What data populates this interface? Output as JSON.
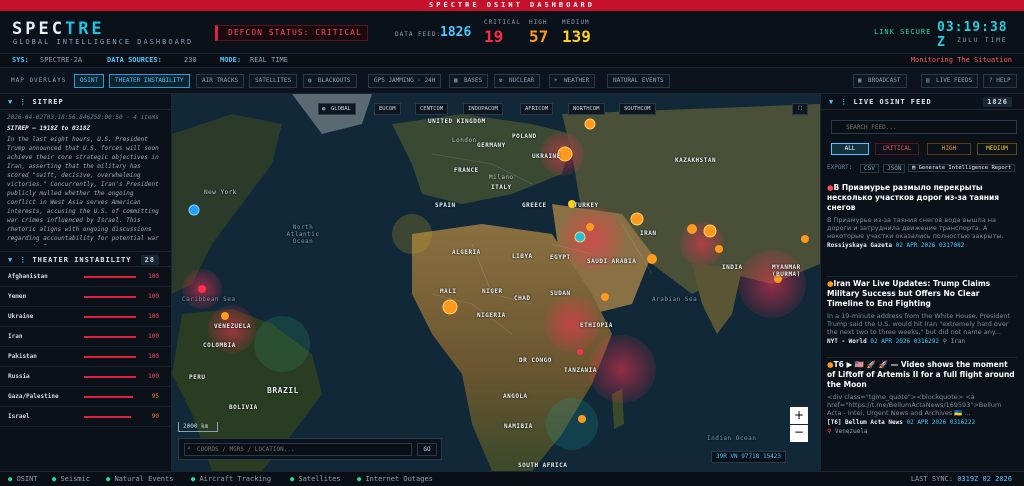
{
  "banner": "SPECTRE OSINT DASHBOARD",
  "header": {
    "logo_a": "SPEC",
    "logo_b": "TRE",
    "subtitle": "GLOBAL INTELLIGENCE DASHBOARD",
    "defcon": "DEFCON STATUS: CRITICAL",
    "data_feed_label": "DATA FEED:",
    "data_feed_value": "1826",
    "critical_label": "CRITICAL",
    "critical_value": "19",
    "high_label": "HIGH",
    "high_value": "57",
    "medium_label": "MEDIUM",
    "medium_value": "139",
    "link_secure": "LINK SECURE",
    "clock": "03:19:38 Z",
    "clock_sub": "ZULU TIME"
  },
  "sysbar": {
    "sys_k": "SYS:",
    "sys_v": "SPECTRE-2A",
    "sources_k": "DATA SOURCES:",
    "sources_v": "230",
    "mode_k": "MODE:",
    "mode_v": "REAL TIME",
    "monitor": "Monitoring The Situation"
  },
  "overlays": {
    "label": "MAP OVERLAYS",
    "items": [
      "OSINT",
      "THEATER INSTABILITY",
      "AIR TRACKS",
      "SATELLITES",
      "BLACKOUTS",
      "GPS JAMMING · 24H",
      "BASES",
      "NUCLEAR",
      "WEATHER",
      "NATURAL EVENTS"
    ],
    "broadcast": "BROADCAST",
    "live_feeds": "LIVE FEEDS",
    "help": "? HELP"
  },
  "sitrep": {
    "title": "SITREP",
    "meta": "2026-04-02T03:18:56.846Z58:00:50 · 4 items",
    "heading": "SITREP — 1918Z to 0318Z",
    "body": "In the last eight hours, U.S. President Trump announced that U.S. forces will soon achieve their core strategic objectives in Iran, asserting that the military has scored \"swift, decisive, overwhelming victories.\" Concurrently, Iran's President publicly mulled whether the ongoing conflict in West Asia serves American interests, accusing the U.S. of committing war crimes influenced by Israel. This rhetoric aligns with ongoing discussions regarding accountability for potential war crimes in Iran"
  },
  "theater": {
    "title": "THEATER INSTABILITY",
    "count": "28",
    "rows": [
      {
        "name": "Afghanistan",
        "value": "100",
        "pct": 100
      },
      {
        "name": "Yemen",
        "value": "100",
        "pct": 100
      },
      {
        "name": "Ukraine",
        "value": "100",
        "pct": 100
      },
      {
        "name": "Iran",
        "value": "100",
        "pct": 100
      },
      {
        "name": "Pakistan",
        "value": "100",
        "pct": 100
      },
      {
        "name": "Russia",
        "value": "100",
        "pct": 100
      },
      {
        "name": "Gaza/Palestine",
        "value": "95",
        "pct": 95
      },
      {
        "name": "Israel",
        "value": "90",
        "pct": 90
      }
    ]
  },
  "map": {
    "regions": [
      "GLOBAL",
      "EUCOM",
      "CENTCOM",
      "INDOPACOM",
      "AFRICOM",
      "NORTHCOM",
      "SOUTHCOM"
    ],
    "scale": "2000 km",
    "coord_placeholder": "COORDS / MGRS / LOCATION...",
    "go": "GO",
    "mgrs": "39R VN 97718 15423",
    "zoom_in": "+",
    "zoom_out": "−",
    "labels": [
      "UNITED KINGDOM",
      "London",
      "POLAND",
      "GERMANY",
      "UKRAINE",
      "KAZAKHSTAN",
      "FRANCE",
      "Milano",
      "ITALY",
      "New York",
      "SPAIN",
      "GREECE",
      "TURKEY",
      "North Atlantic Ocean",
      "IRAN",
      "ALGERIA",
      "LIBYA",
      "EGYPT",
      "SAUDI ARABIA",
      "INDIA",
      "MYANMAR (BURMA)",
      "Caribbean Sea",
      "MALI",
      "NIGER",
      "CHAD",
      "SUDAN",
      "Arabian Sea",
      "VENEZUELA",
      "NIGERIA",
      "ETHIOPIA",
      "COLOMBIA",
      "DR CONGO",
      "PERU",
      "TANZANIA",
      "BRAZIL",
      "BOLIVIA",
      "ANGOLA",
      "NAMIBIA",
      "Indian Ocean",
      "SOUTH AFRICA"
    ]
  },
  "feed": {
    "title": "LIVE OSINT FEED",
    "count": "1826",
    "search_placeholder": "SEARCH FEED...",
    "filters": [
      "ALL",
      "CRITICAL",
      "HIGH",
      "MEDIUM"
    ],
    "export_label": "EXPORT:",
    "csv": "CSV",
    "json": "JSON",
    "report": "Generate Intelligence Report",
    "items": [
      {
        "title": "В Приамурье размыло перекрыты несколько участков дорог из-за таяния снегов",
        "body": "В Приамурье из-за таяния снегов вода вышла на дороги и затруднила движение транспорта. А некоторые участки оказались полностью закрыты.",
        "source": "Rossiyskaya Gazeta",
        "date": "02 APR 2026 0317082",
        "loc": ""
      },
      {
        "title": "Iran War Live Updates: Trump Claims Military Success but Offers No Clear Timeline to End Fighting",
        "body": "In a 19-minute address from the White House, President Trump said the U.S. would hit Iran \"extremely hard over the next two to three weeks,\" but did not name any...",
        "source": "NYT - World",
        "date": "02 APR 2026 0316292",
        "loc": "Iran"
      },
      {
        "title": "T6 ▶ 🇺🇸 🚀 🚀 — Video shows the moment of Liftoff of Artemis II for a full flight around the Moon",
        "body": "<div class=\"tgme_quote\"><blockquote> <a href=\"https://t.me/BellumActaNews/169593\">Bellum Acta - Intel, Urgent News and Archives 🇺🇦 ...",
        "source": "[T6] Bellum Acta News",
        "date": "02 APR 2026 0316222",
        "loc": "Venezuela"
      }
    ]
  },
  "footer": {
    "items": [
      "OSINT",
      "Seismic",
      "Natural Events",
      "Aircraft Tracking",
      "Satellites",
      "Internet Outages"
    ],
    "last_sync_label": "LAST SYNC:",
    "last_sync": "0319Z 02 2026"
  },
  "colors": {
    "critical": "#ff2a44",
    "high": "#ff9a20",
    "medium": "#ffd020",
    "accent": "#20c0e0"
  }
}
